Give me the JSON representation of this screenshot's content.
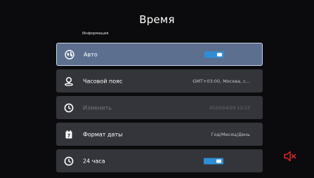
{
  "title": "Время",
  "section_label": "Информация",
  "colors": {
    "background": "#0b0b0d",
    "row": "#34353a",
    "row_selected": "#5d6f8f",
    "toggle_on": "#2f8fd6",
    "mute_icon": "#e0242b"
  },
  "rows": [
    {
      "icon": "globe-icon",
      "label": "Авто",
      "control": "toggle",
      "checked": true,
      "selected": true
    },
    {
      "icon": "location-pin-icon",
      "label": "Часовой пояс",
      "value": "GMT+03:00, Москва, с..."
    },
    {
      "icon": "clock-icon",
      "label": "Изменить",
      "value": "2020/04/29 13:23",
      "disabled": true
    },
    {
      "icon": "calendar-icon",
      "label": "Формат даты",
      "value": "Год/Месяц/День"
    },
    {
      "icon": "clock-24-icon",
      "label": "24 часа",
      "control": "toggle",
      "checked": true
    }
  ],
  "mute_icon": "speaker-muted-icon"
}
